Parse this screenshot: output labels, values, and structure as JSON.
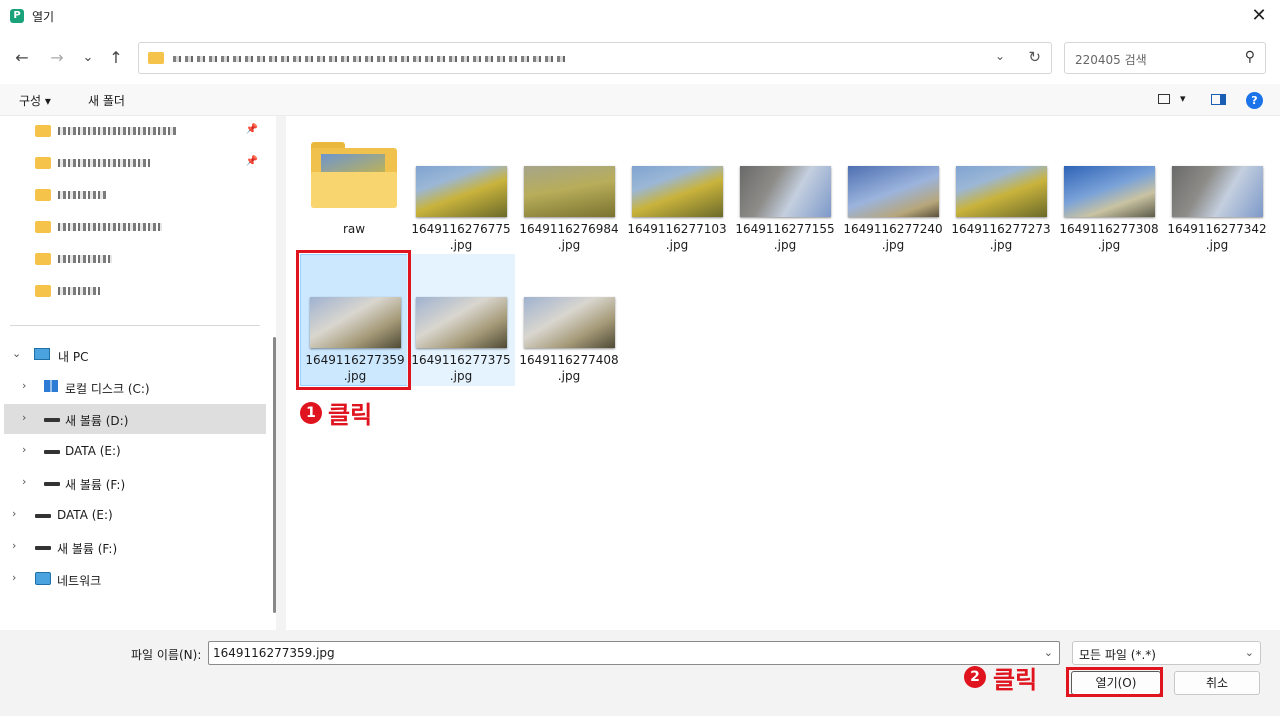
{
  "window": {
    "title": "열기",
    "app_icon": "app-icon",
    "close_glyph": "✕"
  },
  "nav": {
    "back": "←",
    "forward": "→",
    "recent": "⌄",
    "up": "↑",
    "address_dropdown": "⌄",
    "refresh": "↻",
    "search_placeholder": "220405 검색",
    "search_icon": "⚲"
  },
  "toolbar": {
    "organize": "구성 ▾",
    "new_folder": "새 폴더",
    "view_dropdown": "▾",
    "help": "?"
  },
  "sidebar": {
    "quick_access_count": 6,
    "tree": [
      {
        "label": "내 PC",
        "chevron": "⌄",
        "icon": "pc-icon"
      },
      {
        "label": "로컬 디스크 (C:)",
        "chevron": "›",
        "icon": "windows-drive-icon"
      },
      {
        "label": "새 볼륨 (D:)",
        "chevron": "›",
        "icon": "drive-icon"
      },
      {
        "label": "DATA (E:)",
        "chevron": "›",
        "icon": "drive-icon"
      },
      {
        "label": "새 볼륨 (F:)",
        "chevron": "›",
        "icon": "drive-icon"
      },
      {
        "label": "DATA (E:)",
        "chevron": "›",
        "icon": "drive-icon"
      },
      {
        "label": "새 볼륨 (F:)",
        "chevron": "›",
        "icon": "drive-icon"
      },
      {
        "label": "네트워크",
        "chevron": "›",
        "icon": "network-icon"
      }
    ],
    "pin": "📌"
  },
  "files": [
    {
      "name": "raw",
      "type": "folder"
    },
    {
      "name1": "1649116276775",
      "name2": ".jpg"
    },
    {
      "name1": "1649116276984",
      "name2": ".jpg"
    },
    {
      "name1": "1649116277103",
      "name2": ".jpg"
    },
    {
      "name1": "1649116277155",
      "name2": ".jpg"
    },
    {
      "name1": "1649116277240",
      "name2": ".jpg"
    },
    {
      "name1": "1649116277273",
      "name2": ".jpg"
    },
    {
      "name1": "1649116277308",
      "name2": ".jpg"
    },
    {
      "name1": "1649116277342",
      "name2": ".jpg"
    },
    {
      "name1": "1649116277359",
      "name2": ".jpg"
    },
    {
      "name1": "1649116277375",
      "name2": ".jpg"
    },
    {
      "name1": "1649116277408",
      "name2": ".jpg"
    }
  ],
  "annotations": {
    "step1_num": "1",
    "step1_text": "클릭",
    "step2_num": "2",
    "step2_text": "클릭",
    "color": "#e0141e"
  },
  "bottom": {
    "filename_label": "파일 이름(N):",
    "filename_value": "1649116277359.jpg",
    "dropdown_glyph": "⌄",
    "filetype": "모든 파일 (*.*)",
    "open_button": "열기(O)",
    "cancel_button": "취소"
  }
}
